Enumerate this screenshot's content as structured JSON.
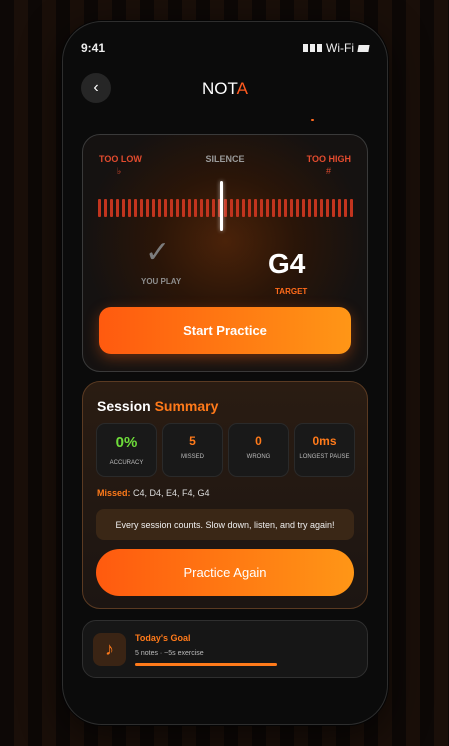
{
  "status": {
    "time": "9:41",
    "wifi": "Wi-Fi"
  },
  "header": {
    "back_symbol": "‹",
    "logo_prefix": "NOT",
    "logo_accent": "A"
  },
  "tuner": {
    "label_low": "TOO LOW",
    "label_silence": "SILENCE",
    "label_high": "TOO HIGH",
    "flat_symbol": "♭",
    "sharp_symbol": "#",
    "check_symbol": "✓",
    "you_play": "YOU PLAY",
    "note": "G4",
    "target_label": "TARGET",
    "start_button": "Start Practice"
  },
  "summary": {
    "title_white": "Session",
    "title_accent": "Summary",
    "stats": [
      {
        "value": "0%",
        "label": "ACCURACY",
        "color": "#6edc3a"
      },
      {
        "value": "5",
        "label": "MISSED",
        "color": "#ff7a1a"
      },
      {
        "value": "0",
        "label": "WRONG",
        "color": "#ff7a1a"
      },
      {
        "value": "0ms",
        "label": "LONGEST PAUSE",
        "color": "#ff7a1a"
      }
    ],
    "missed_label": "Missed:",
    "missed_notes": "C4, D4, E4, F4, G4",
    "message": "Every session counts. Slow down, listen, and try again!",
    "again_button": "Practice Again"
  },
  "goal": {
    "icon": "♪",
    "title": "Today's Goal",
    "subtitle": "5 notes · ~5s exercise",
    "progress": 1.0
  },
  "colors": {
    "accent": "#ff7a1a",
    "meter": "#c2341e",
    "success": "#6edc3a"
  }
}
